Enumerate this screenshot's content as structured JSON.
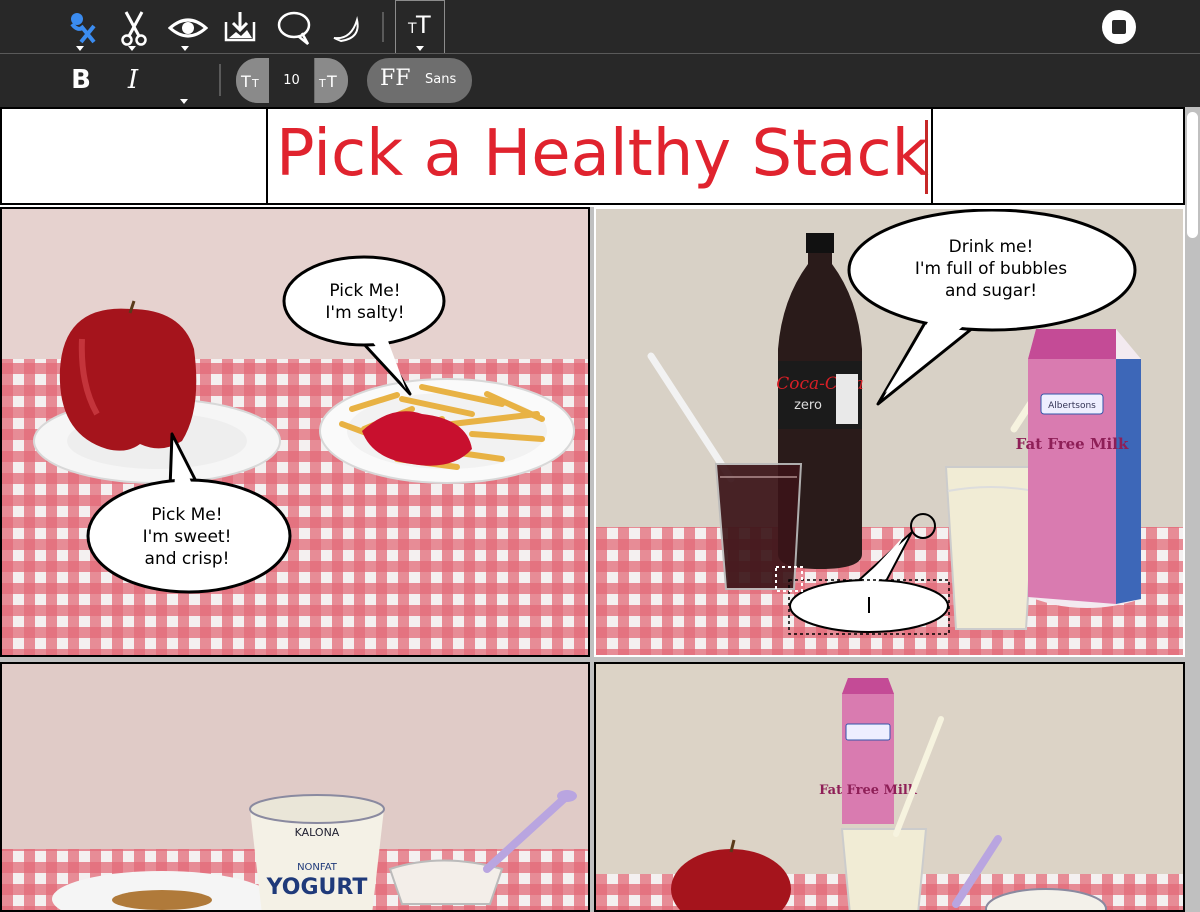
{
  "toolbar": {
    "icons": [
      "activity-icon",
      "scissors-icon",
      "eye-icon",
      "download-icon",
      "speech-bubble-icon",
      "moon-icon",
      "text-size-icon",
      "stop-icon"
    ]
  },
  "format": {
    "bold": "B",
    "italic": "I",
    "font_size": "10",
    "font_family_icon": "FF",
    "font_family": "Sans"
  },
  "title": "Pick a Healthy Stack",
  "panels": [
    {
      "bubbles": [
        {
          "lines": [
            "Pick Me!",
            "I'm salty!"
          ]
        },
        {
          "lines": [
            "Pick Me!",
            "I'm sweet!",
            "and crisp!"
          ]
        }
      ]
    },
    {
      "bubbles": [
        {
          "lines": [
            "Drink me!",
            "I'm full of bubbles",
            "and sugar!"
          ]
        },
        {
          "lines": [
            ""
          ]
        }
      ]
    }
  ],
  "photo_text": {
    "coke": "Coca-Cola",
    "coke_zero": "zero",
    "milk": "Fat Free Milk",
    "milk_brand": "Albertsons",
    "yogurt_brand": "KALONA",
    "yogurt": "YOGURT",
    "yogurt_type": "NONFAT"
  },
  "colors": {
    "title": "#e0232e",
    "toolbar": "#282828",
    "tablecloth_red": "#d8283a"
  }
}
